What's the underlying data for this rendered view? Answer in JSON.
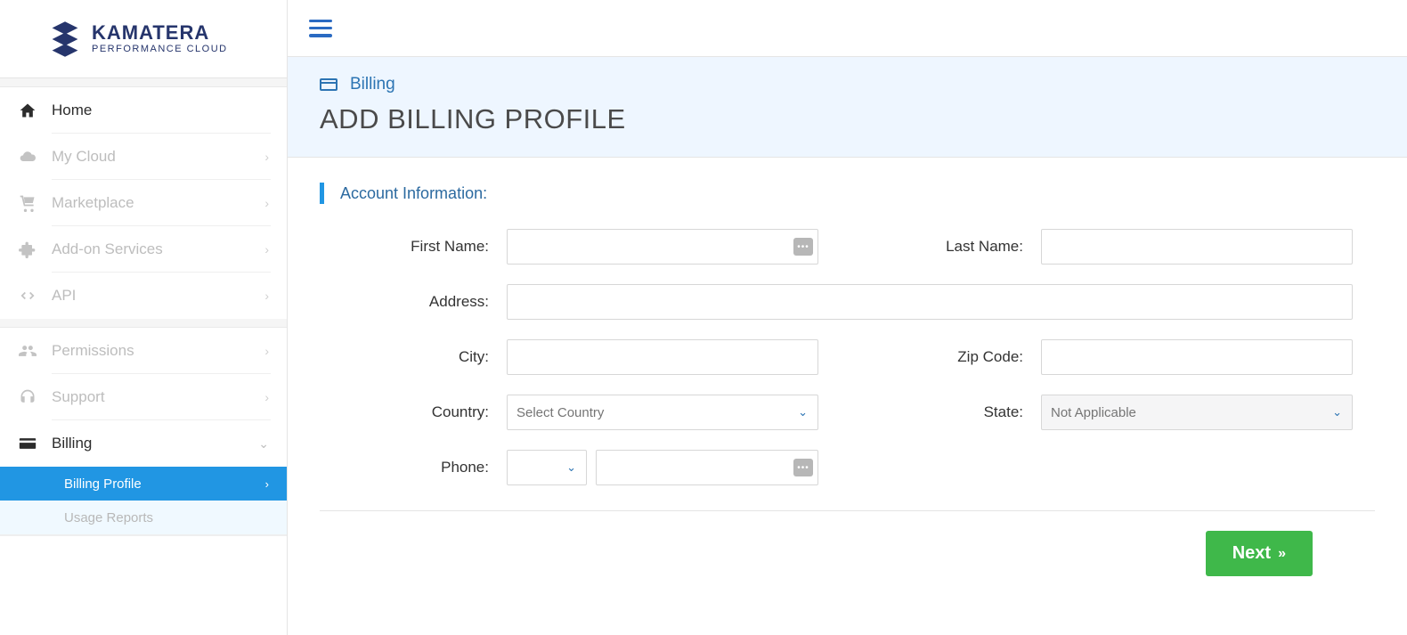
{
  "brand": {
    "title": "KAMATERA",
    "subtitle": "PERFORMANCE CLOUD"
  },
  "sidebar": {
    "items": [
      {
        "label": "Home"
      },
      {
        "label": "My Cloud"
      },
      {
        "label": "Marketplace"
      },
      {
        "label": "Add-on Services"
      },
      {
        "label": "API"
      },
      {
        "label": "Permissions"
      },
      {
        "label": "Support"
      },
      {
        "label": "Billing"
      }
    ],
    "billing_sub": [
      {
        "label": "Billing Profile"
      },
      {
        "label": "Usage Reports"
      }
    ]
  },
  "breadcrumb": {
    "label": "Billing"
  },
  "page": {
    "title": "ADD BILLING PROFILE"
  },
  "section": {
    "title": "Account Information:"
  },
  "form": {
    "first_name": {
      "label": "First Name:",
      "value": ""
    },
    "last_name": {
      "label": "Last Name:",
      "value": ""
    },
    "address": {
      "label": "Address:",
      "value": ""
    },
    "city": {
      "label": "City:",
      "value": ""
    },
    "zip": {
      "label": "Zip Code:",
      "value": ""
    },
    "country": {
      "label": "Country:",
      "placeholder": "Select Country"
    },
    "state": {
      "label": "State:",
      "placeholder": "Not Applicable"
    },
    "phone": {
      "label": "Phone:",
      "cc": "",
      "number": ""
    }
  },
  "actions": {
    "next": "Next"
  }
}
